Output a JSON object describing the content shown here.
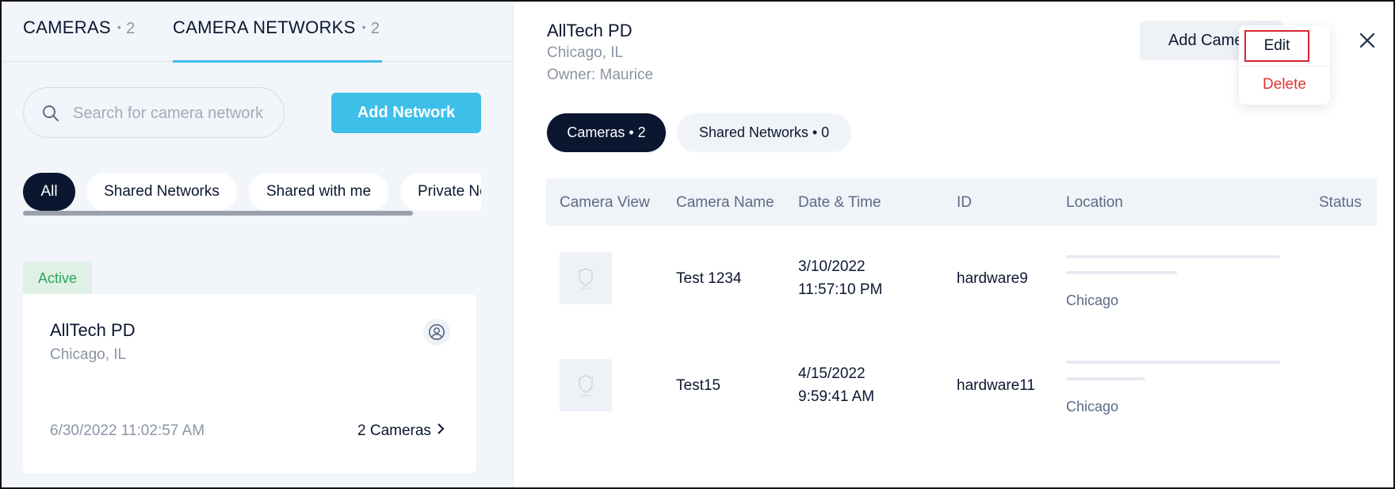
{
  "left_panel": {
    "tabs": [
      {
        "label": "CAMERAS",
        "count": "2"
      },
      {
        "label": "CAMERA NETWORKS",
        "count": "2"
      }
    ],
    "search": {
      "placeholder": "Search for camera network"
    },
    "add_network_label": "Add Network",
    "filters": [
      "All",
      "Shared Networks",
      "Shared with me",
      "Private Ne"
    ],
    "status_badge": "Active",
    "network_card": {
      "title": "AllTech PD",
      "location": "Chicago, IL",
      "date": "6/30/2022 11:02:57 AM",
      "cameras_link": "2 Cameras"
    }
  },
  "detail": {
    "title": "AllTech PD",
    "location": "Chicago, IL",
    "owner": "Owner: Maurice",
    "add_camera_label": "Add Came",
    "menu": {
      "edit": "Edit",
      "delete": "Delete"
    },
    "tabs": [
      {
        "label": "Cameras • 2",
        "active": true
      },
      {
        "label": "Shared Networks • 0",
        "active": false
      }
    ],
    "table": {
      "columns": [
        "Camera View",
        "Camera Name",
        "Date & Time",
        "ID",
        "Location",
        "Status"
      ],
      "rows": [
        {
          "name": "Test 1234",
          "date": "3/10/2022",
          "time": "11:57:10 PM",
          "id": "hardware9",
          "city": "Chicago"
        },
        {
          "name": "Test15",
          "date": "4/15/2022",
          "time": "9:59:41 AM",
          "id": "hardware11",
          "city": "Chicago"
        }
      ]
    }
  },
  "colors": {
    "accent": "#3cbfe8",
    "dark": "#0b1730",
    "active_green": "#2aa55a",
    "delete_red": "#e3322f",
    "highlight_red": "#d6262f"
  }
}
